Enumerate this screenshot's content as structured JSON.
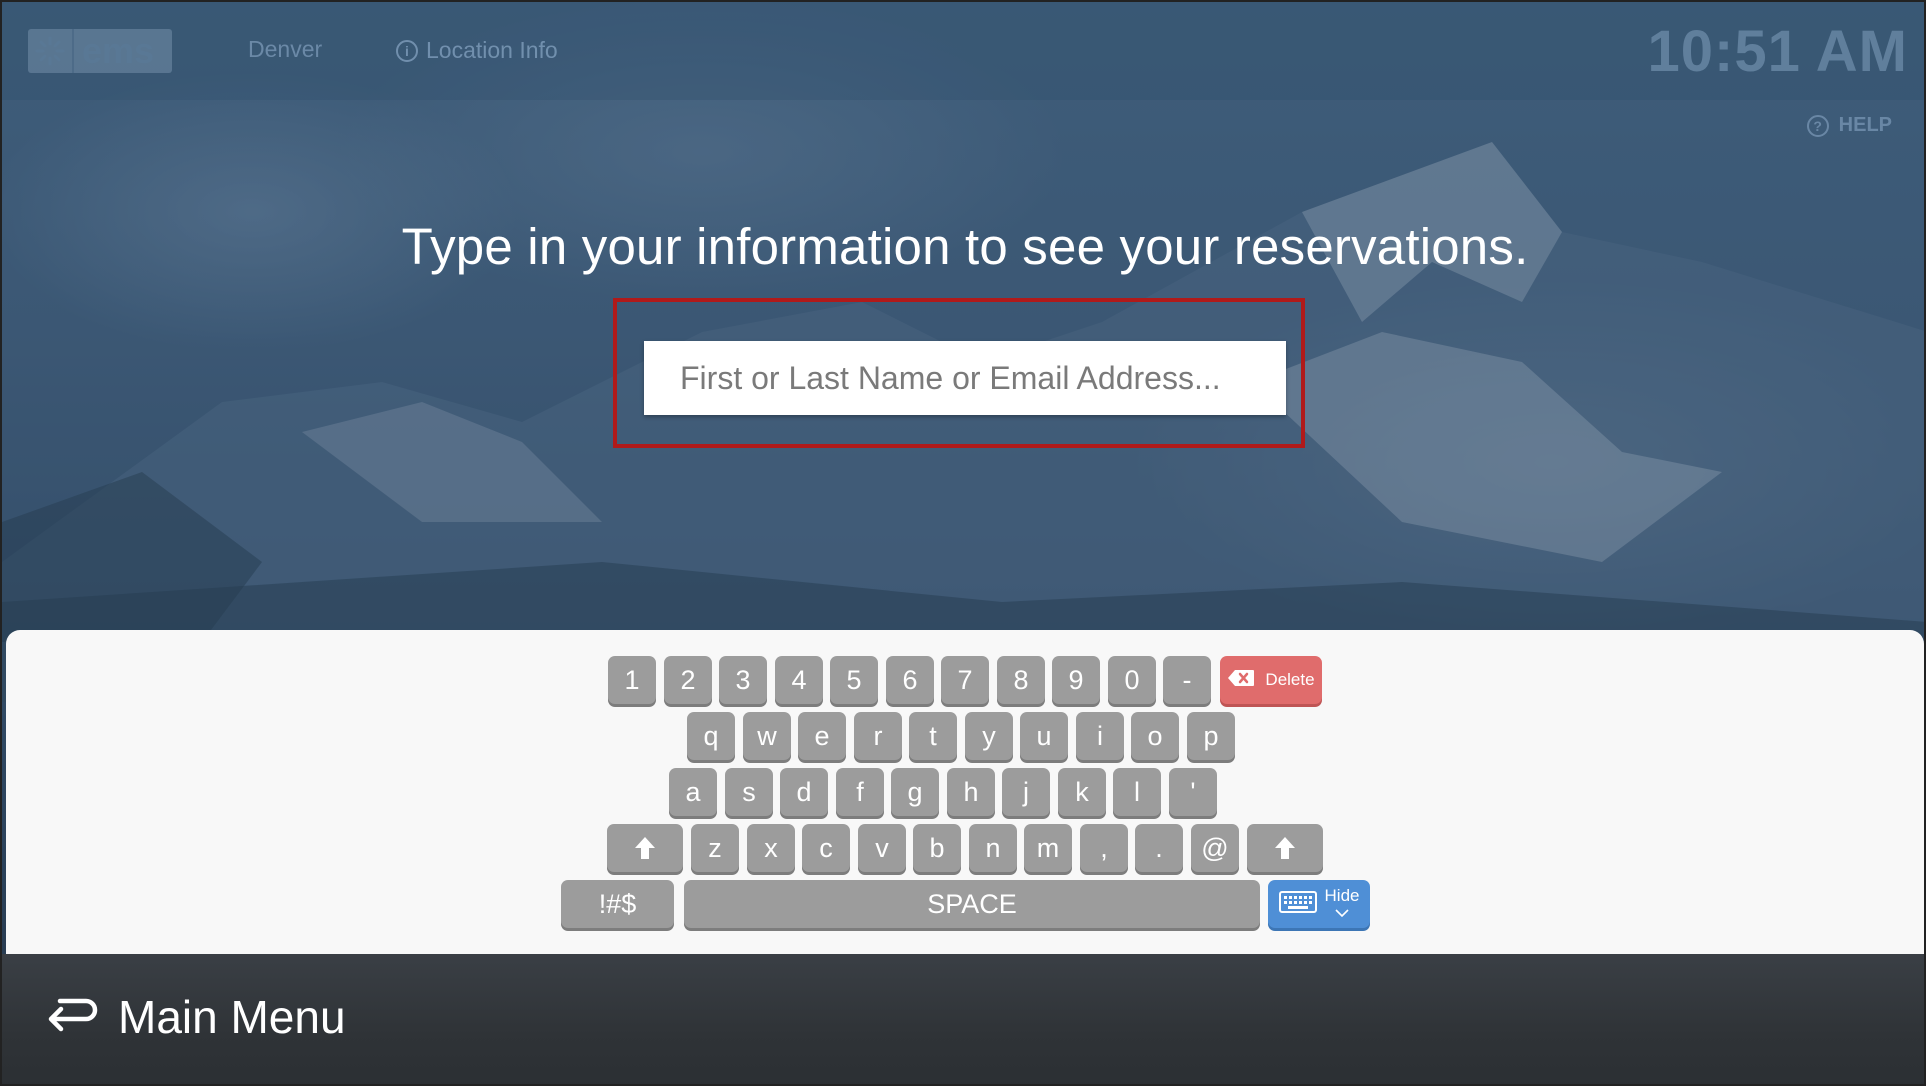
{
  "header": {
    "logo_text": "ems",
    "location_name": "Denver",
    "location_info_label": "Location Info",
    "clock": "10:51 AM",
    "help_label": "HELP"
  },
  "main": {
    "prompt": "Type in your information to see your reservations.",
    "search_placeholder": "First or Last Name or Email Address..."
  },
  "keyboard": {
    "row1": [
      "1",
      "2",
      "3",
      "4",
      "5",
      "6",
      "7",
      "8",
      "9",
      "0",
      "-"
    ],
    "delete_label": "Delete",
    "row2": [
      "q",
      "w",
      "e",
      "r",
      "t",
      "y",
      "u",
      "i",
      "o",
      "p"
    ],
    "row3": [
      "a",
      "s",
      "d",
      "f",
      "g",
      "h",
      "j",
      "k",
      "l",
      "'"
    ],
    "row4": [
      "z",
      "x",
      "c",
      "v",
      "b",
      "n",
      "m",
      ",",
      ".",
      "@"
    ],
    "symbols_label": "!#$",
    "space_label": "SPACE",
    "hide_label": "Hide"
  },
  "footer": {
    "main_menu_label": "Main Menu"
  }
}
